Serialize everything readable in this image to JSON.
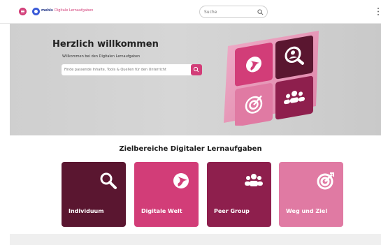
{
  "header": {
    "logo_text": "mebis",
    "breadcrumb_sep": "›",
    "breadcrumb_item": "Digitale Lernaufgaben",
    "search_placeholder": "Suche",
    "icons": [
      "menu-icon",
      "search-icon",
      "more-vertical-icon"
    ]
  },
  "hero": {
    "title": "Herzlich willkommen",
    "subtitle": "Willkommen bei den Digitalen Lernaufgaben",
    "search_placeholder": "Finde passende Inhalte, Tools & Quellen für den Unterricht"
  },
  "section": {
    "title": "Zielbereiche Digitaler Lernaufgaben"
  },
  "cards": [
    {
      "label": "Individuum",
      "icon": "magnifier-icon",
      "color": "#5a1630"
    },
    {
      "label": "Digitale Welt",
      "icon": "globe-icon",
      "color": "#d23d78"
    },
    {
      "label": "Peer Group",
      "icon": "group-icon",
      "color": "#8e1f4d"
    },
    {
      "label": "Weg und Ziel",
      "icon": "target-icon",
      "color": "#e07aa3"
    }
  ],
  "colors": {
    "brand_pink": "#d23d78",
    "dark_wine": "#5a1630",
    "berry": "#8e1f4d",
    "light_pink": "#e07aa3"
  }
}
